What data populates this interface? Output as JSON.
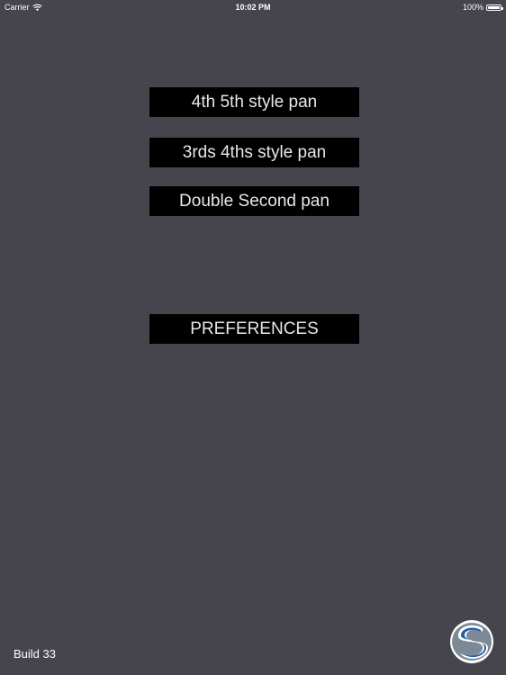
{
  "status_bar": {
    "carrier": "Carrier",
    "time": "10:02 PM",
    "battery_percent": "100%",
    "battery_level": 1.0,
    "wifi_icon": "wifi-icon",
    "battery_icon": "battery-icon"
  },
  "menu": {
    "buttons": [
      {
        "label": "4th 5th style pan"
      },
      {
        "label": "3rds 4ths style pan"
      },
      {
        "label": "Double Second pan"
      },
      {
        "label": "PREFERENCES"
      }
    ]
  },
  "footer": {
    "build": "Build 33",
    "logo_icon": "app-logo-icon"
  },
  "colors": {
    "background": "#46444d",
    "button_bg": "#000000",
    "button_text": "#e8e8e8",
    "logo_blue": "#1f5fa8",
    "logo_grey": "#7b8a96"
  }
}
